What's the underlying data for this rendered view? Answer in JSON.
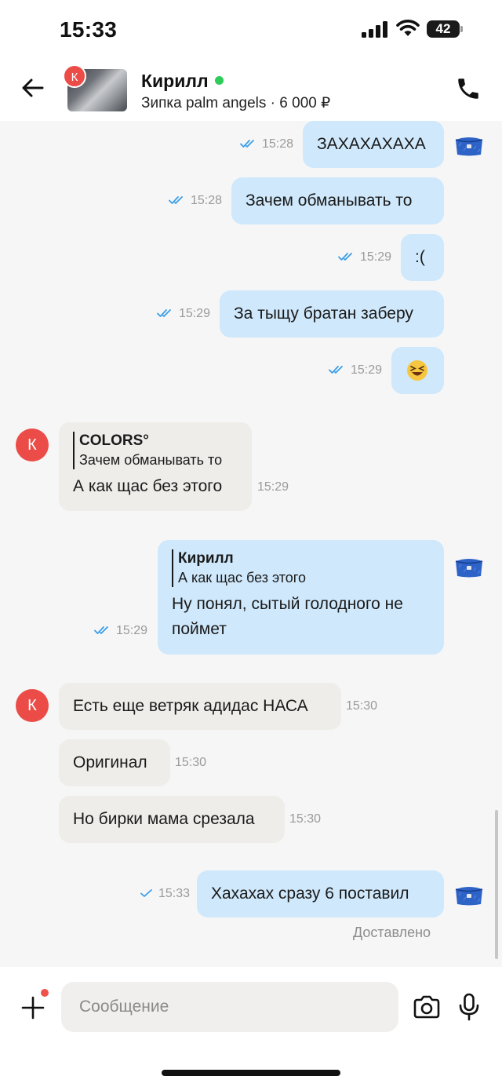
{
  "status_bar": {
    "time": "15:33",
    "battery": "42"
  },
  "header": {
    "contact_name": "Кирилл",
    "listing": "Зипка palm angels · 6 000 ₽",
    "avatar_letter": "К"
  },
  "messages": [
    {
      "text": "ЗАХАХАХАХА",
      "time": "15:28"
    },
    {
      "text": "Зачем обманывать то",
      "time": "15:28"
    },
    {
      "text": ":(",
      "time": "15:29"
    },
    {
      "text": "За тыщу братан заберу",
      "time": "15:29"
    },
    {
      "text": "😆",
      "time": "15:29"
    },
    {
      "quote_name": "COLORS°",
      "quote_text": "Зачем обманывать то",
      "text": "А как щас без этого",
      "time": "15:29"
    },
    {
      "quote_name": "Кирилл",
      "quote_text": "А как щас без этого",
      "line1": "Ну понял, сытый голодного не",
      "line2": "поймет",
      "time": "15:29"
    },
    {
      "text": "Есть еще ветряк адидас НАСА",
      "time": "15:30"
    },
    {
      "text": "Оригинал",
      "time": "15:30"
    },
    {
      "text": "Но бирки мама срезала",
      "time": "15:30"
    },
    {
      "text": "Хахахах сразу 6 поставил",
      "time": "15:33"
    }
  ],
  "delivered": "Доставлено",
  "composer": {
    "placeholder": "Сообщение"
  },
  "colors": {
    "outgoing_bubble": "#cfe8fb",
    "incoming_bubble": "#efedea",
    "read_tick": "#3b9ee8",
    "avatar": "#ec4c47",
    "online": "#2ecc59"
  }
}
